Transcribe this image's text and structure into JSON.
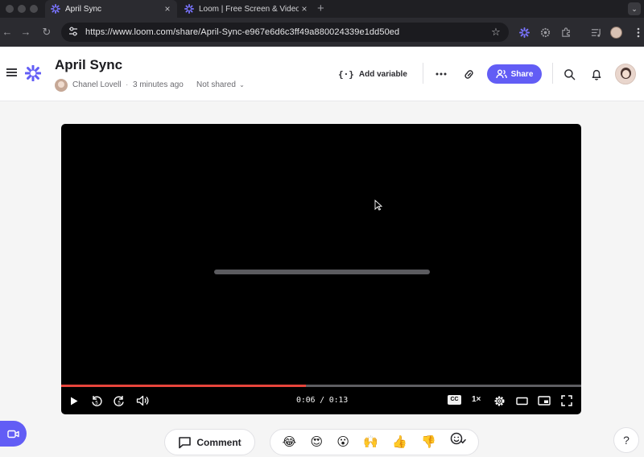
{
  "browser": {
    "tabs": [
      {
        "title": "April Sync",
        "active": true,
        "icon": "loom-logo-icon"
      },
      {
        "title": "Loom | Free Screen & Video R",
        "active": false,
        "icon": "loom-logo-icon"
      }
    ],
    "new_tab": "+",
    "close_glyph": "×",
    "address_bar": {
      "url": "https://www.loom.com/share/April-Sync-e967e6d6c3ff49a880024339e1dd50ed"
    }
  },
  "header": {
    "title": "April Sync",
    "owner": "Chanel Lovell",
    "separator": "·",
    "time_ago": "3 minutes ago",
    "share_state": "Not shared",
    "add_variable_label": "Add variable",
    "share_label": "Share"
  },
  "player": {
    "current_time": "0:06",
    "total_time": "0:13",
    "time_separator": " / ",
    "progress": 0.47,
    "cc_label": "CC",
    "speed_label": "1×"
  },
  "footer": {
    "comment_label": "Comment",
    "reactions": [
      "😂",
      "😍",
      "😮",
      "🙌",
      "👍",
      "👎"
    ],
    "help_label": "?"
  },
  "colors": {
    "brand": "#625df5",
    "progress": "#e8453c"
  }
}
